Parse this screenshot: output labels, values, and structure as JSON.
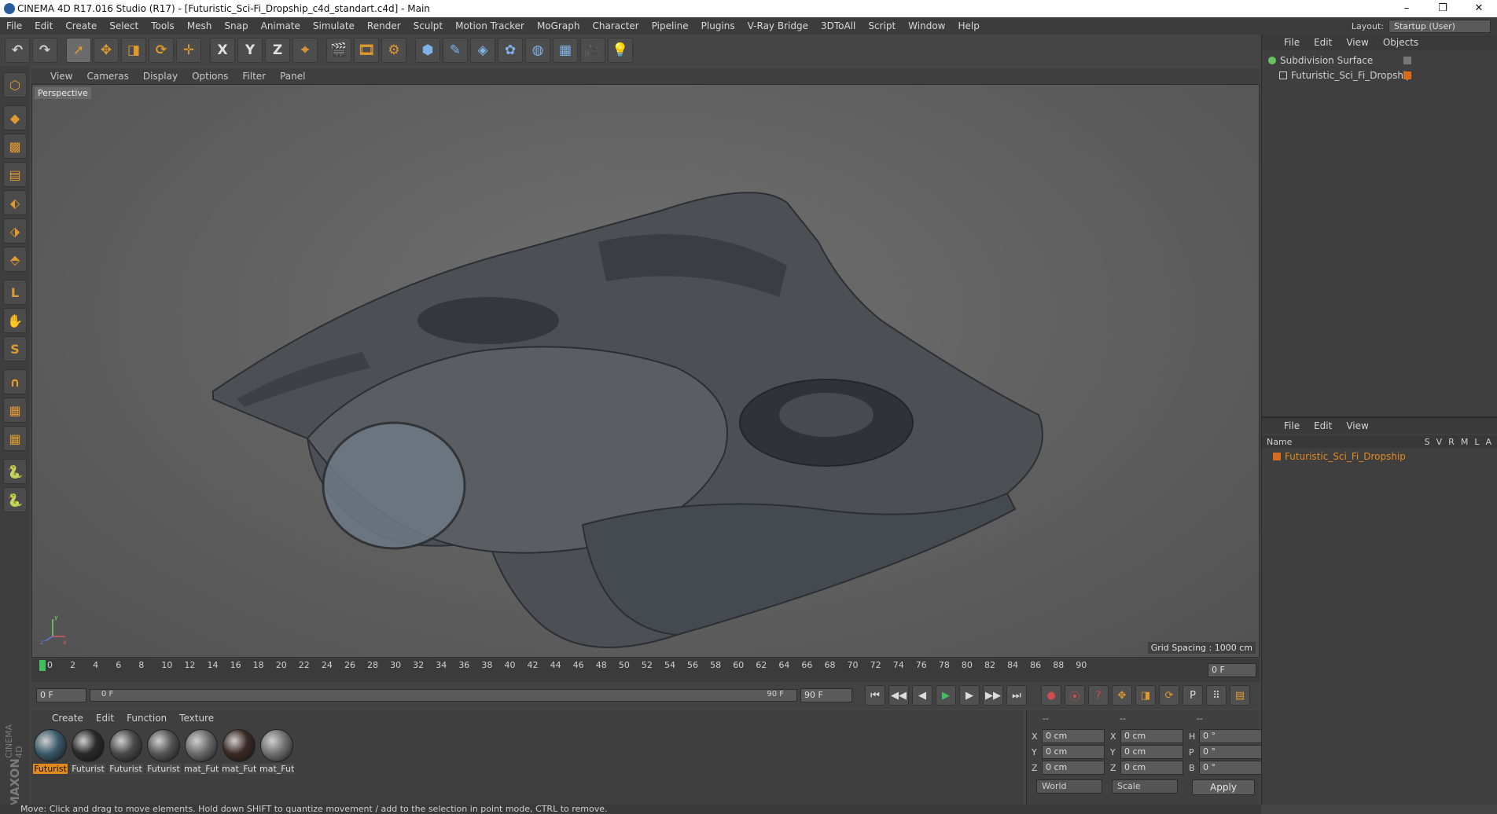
{
  "window": {
    "title": "CINEMA 4D R17.016 Studio (R17) - [Futuristic_Sci-Fi_Dropship_c4d_standart.c4d] - Main",
    "minimize": "–",
    "restore": "❐",
    "close": "✕"
  },
  "menubar": {
    "items": [
      "File",
      "Edit",
      "Create",
      "Select",
      "Tools",
      "Mesh",
      "Snap",
      "Animate",
      "Simulate",
      "Render",
      "Sculpt",
      "Motion Tracker",
      "MoGraph",
      "Character",
      "Pipeline",
      "Plugins",
      "V-Ray Bridge",
      "3DToAll",
      "Script",
      "Window",
      "Help"
    ],
    "layout_label": "Layout:",
    "layout_value": "Startup (User)"
  },
  "toolbar": {
    "icons": [
      "undo-icon",
      "redo-icon",
      "select-arrow-icon",
      "move-icon",
      "scale-icon",
      "rotate-icon",
      "transform-icon",
      "x-axis-icon",
      "y-axis-icon",
      "z-axis-icon",
      "coordinate-system-icon",
      "render-view-icon",
      "render-picture-viewer-icon",
      "render-settings-icon",
      "cube-icon",
      "pen-icon",
      "subdivision-icon",
      "mograph-cloner-icon",
      "deformer-icon",
      "floor-icon",
      "camera-icon",
      "light-icon"
    ],
    "glyphs": [
      "↶",
      "↷",
      "➚",
      "✥",
      "◨",
      "⟳",
      "✛",
      "X",
      "Y",
      "Z",
      "⌖",
      "🎬",
      "🎞",
      "⚙",
      "⬢",
      "✎",
      "◈",
      "✿",
      "◍",
      "▦",
      "🎥",
      "💡"
    ]
  },
  "lefttoolbar": {
    "icons": [
      "make-editable-icon",
      "model-mode-icon",
      "texture-mode-icon",
      "workplane-icon",
      "points-mode-icon",
      "edges-mode-icon",
      "polygons-mode-icon",
      "axis-mode-icon",
      "tweak-icon",
      "snap-s-icon",
      "magnet-icon",
      "sculpt-grid-icon",
      "sculpt-grid2-icon",
      "python-icon",
      "python2-icon"
    ],
    "glyphs": [
      "⬡",
      "◆",
      "▩",
      "▤",
      "⬖",
      "⬗",
      "⬘",
      "L",
      "✋",
      "S",
      "∩",
      "▦",
      "▦",
      "🐍",
      "🐍"
    ]
  },
  "viewport": {
    "menu": [
      "View",
      "Cameras",
      "Display",
      "Options",
      "Filter",
      "Panel"
    ],
    "label": "Perspective",
    "grid_spacing": "Grid Spacing : 1000 cm",
    "axis_y": "y",
    "axis_x": "x",
    "axis_z": "z"
  },
  "timeline": {
    "ticks": [
      "0",
      "2",
      "4",
      "6",
      "8",
      "10",
      "12",
      "14",
      "16",
      "18",
      "20",
      "22",
      "24",
      "26",
      "28",
      "30",
      "32",
      "34",
      "36",
      "38",
      "40",
      "42",
      "44",
      "46",
      "48",
      "50",
      "52",
      "54",
      "56",
      "58",
      "60",
      "62",
      "64",
      "66",
      "68",
      "70",
      "72",
      "74",
      "76",
      "78",
      "80",
      "82",
      "84",
      "86",
      "88",
      "90"
    ],
    "current_frame": "0 F"
  },
  "controls": {
    "start_field": "0 F",
    "range_start": "0 F",
    "range_end": "90 F",
    "end_field": "90 F",
    "buttons": [
      "⏮",
      "◀◀",
      "◀",
      "▶",
      "▶",
      "▶▶",
      "⏭"
    ]
  },
  "materials": {
    "menu": [
      "Create",
      "Edit",
      "Function",
      "Texture"
    ],
    "items": [
      {
        "name": "Futurist",
        "color": "#3a5a6a",
        "selected": true
      },
      {
        "name": "Futurist",
        "color": "#2a2a2a",
        "selected": false
      },
      {
        "name": "Futurist",
        "color": "#4a4a4a",
        "selected": false
      },
      {
        "name": "Futurist",
        "color": "#555555",
        "selected": false
      },
      {
        "name": "mat_Fut",
        "color": "#6a6a6a",
        "selected": false
      },
      {
        "name": "mat_Fut",
        "color": "#3a2a24",
        "selected": false
      },
      {
        "name": "mat_Fut",
        "color": "#707070",
        "selected": false
      }
    ],
    "brand1": "MAXON",
    "brand2": "CINEMA 4D"
  },
  "coordinates": {
    "head": [
      "--",
      "--",
      "--"
    ],
    "rows": [
      {
        "a": "X",
        "v1": "0 cm",
        "b": "X",
        "v2": "0 cm",
        "c": "H",
        "v3": "0 °"
      },
      {
        "a": "Y",
        "v1": "0 cm",
        "b": "Y",
        "v2": "0 cm",
        "c": "P",
        "v3": "0 °"
      },
      {
        "a": "Z",
        "v1": "0 cm",
        "b": "Z",
        "v2": "0 cm",
        "c": "B",
        "v3": "0 °"
      }
    ],
    "world": "World",
    "scale": "Scale",
    "apply": "Apply"
  },
  "objects": {
    "menu": [
      "File",
      "Edit",
      "View",
      "Objects"
    ],
    "rows": [
      {
        "name": "Subdivision Surface",
        "color": "#67c25f"
      },
      {
        "name": "Futuristic_Sci_Fi_Dropship",
        "color": "#d86b1c"
      }
    ]
  },
  "attributes": {
    "menu": [
      "File",
      "Edit",
      "View"
    ],
    "head_name": "Name",
    "cols": [
      "S",
      "V",
      "R",
      "M",
      "L",
      "A"
    ],
    "row": "Futuristic_Sci_Fi_Dropship"
  },
  "status": "Move: Click and drag to move elements. Hold down SHIFT to quantize movement / add to the selection in point mode, CTRL to remove.",
  "colors": {
    "accent": "#e38a1d",
    "selected_text": "#e38a1d",
    "green": "#67c25f"
  }
}
